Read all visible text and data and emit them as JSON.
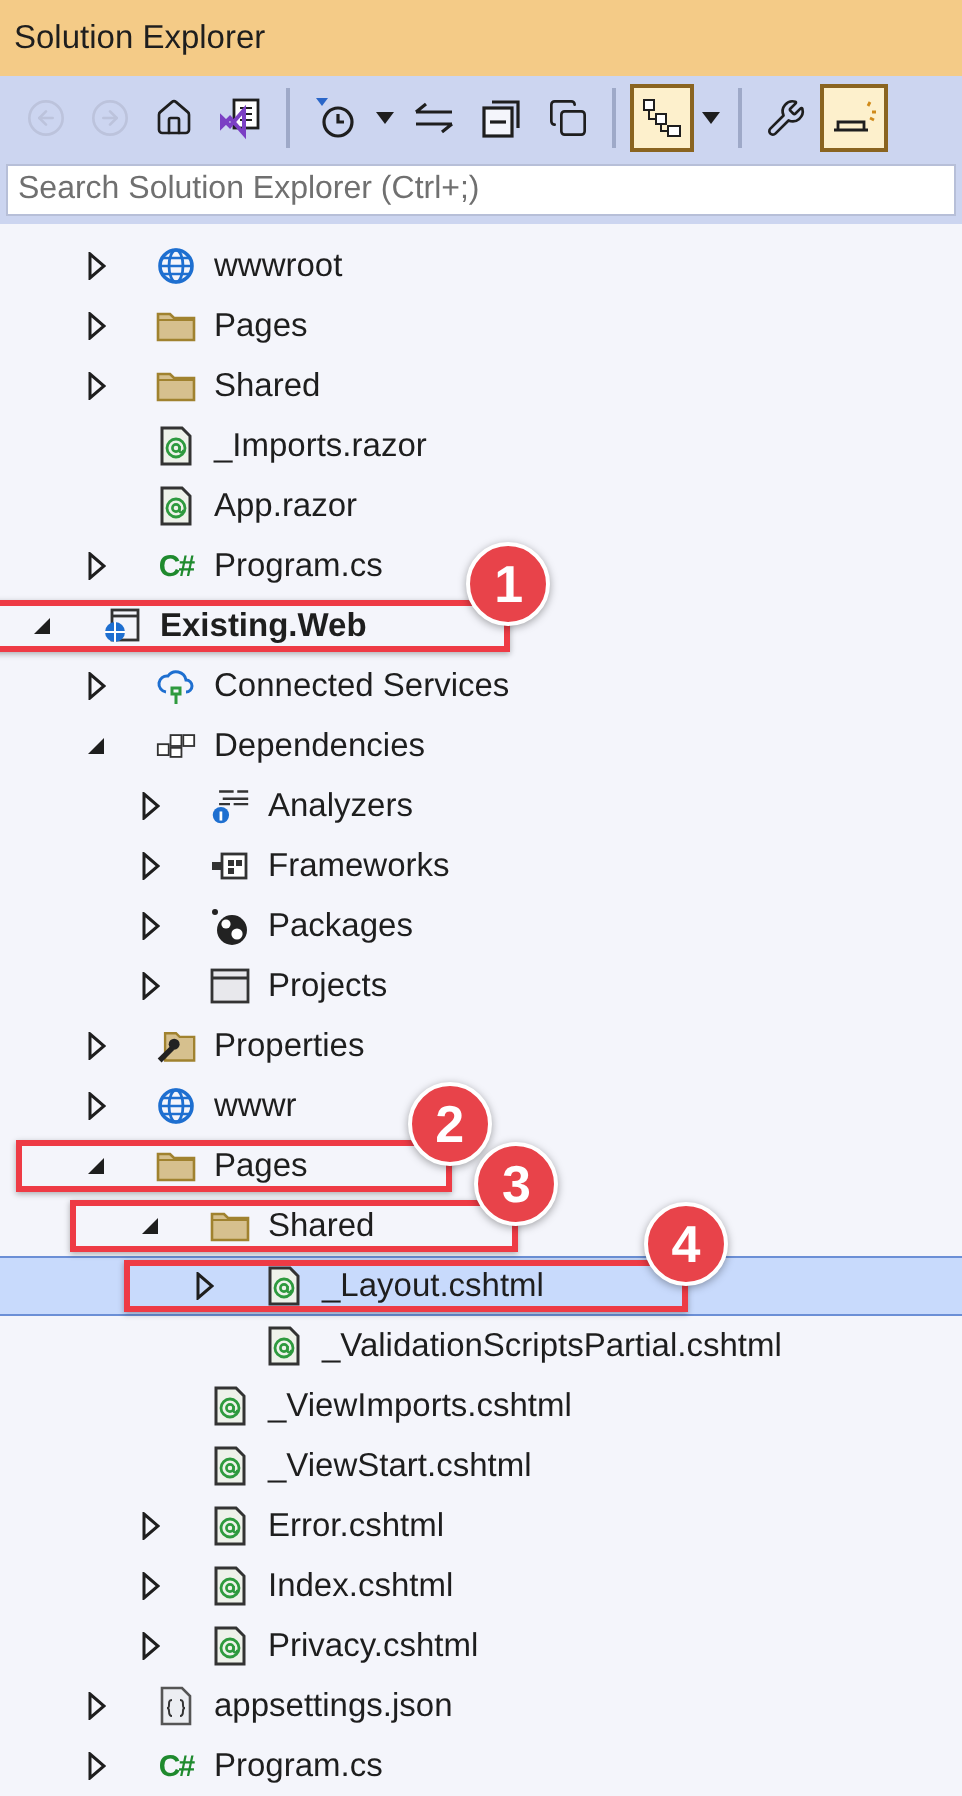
{
  "window": {
    "title": "Solution Explorer"
  },
  "toolbar": [
    {
      "kind": "back",
      "disabled": true
    },
    {
      "kind": "forward",
      "disabled": true
    },
    {
      "kind": "home",
      "disabled": false
    },
    {
      "kind": "solution",
      "disabled": false
    },
    {
      "kind": "separator"
    },
    {
      "kind": "history",
      "disabled": false,
      "dropdown": true
    },
    {
      "kind": "sync",
      "disabled": false
    },
    {
      "kind": "collapse",
      "disabled": false
    },
    {
      "kind": "copies",
      "disabled": false
    },
    {
      "kind": "separator"
    },
    {
      "kind": "tree",
      "disabled": false,
      "toggled": true,
      "dropdown": true
    },
    {
      "kind": "separator"
    },
    {
      "kind": "properties",
      "disabled": false,
      "toggled": false
    },
    {
      "kind": "preview",
      "disabled": false,
      "toggled": true
    }
  ],
  "search": {
    "placeholder": "Search Solution Explorer (Ctrl+;)"
  },
  "tree_continued": [
    {
      "label": "wwwroot",
      "kind": "globe",
      "expanded": false,
      "selected": false
    },
    {
      "label": "Pages",
      "kind": "folder",
      "expanded": false,
      "selected": false
    },
    {
      "label": "Shared",
      "kind": "folder",
      "expanded": false,
      "selected": false
    },
    {
      "label": "_Imports.razor",
      "kind": "razor",
      "selected": false
    },
    {
      "label": "App.razor",
      "kind": "razor",
      "selected": false
    },
    {
      "label": "Program.cs",
      "kind": "csharp",
      "icon_text": "C#",
      "expanded": false,
      "selected": false
    }
  ],
  "tree": [
    {
      "label": "Existing.Web",
      "kind": "project",
      "expanded": true,
      "selected": false,
      "bold": true,
      "callout": "1",
      "children": [
        {
          "label": "Connected Services",
          "kind": "connected",
          "expanded": false,
          "selected": false
        },
        {
          "label": "Dependencies",
          "kind": "dependencies",
          "expanded": true,
          "selected": false,
          "children": [
            {
              "label": "Analyzers",
              "kind": "analyzers",
              "expanded": false,
              "selected": false
            },
            {
              "label": "Frameworks",
              "kind": "frameworks",
              "expanded": false,
              "selected": false
            },
            {
              "label": "Packages",
              "kind": "packages",
              "expanded": false,
              "selected": false
            },
            {
              "label": "Projects",
              "kind": "projects",
              "expanded": false,
              "selected": false
            }
          ]
        },
        {
          "label": "Properties",
          "kind": "properties",
          "expanded": false,
          "selected": false
        },
        {
          "label": "wwwr",
          "kind": "globe",
          "expanded": false,
          "selected": false
        },
        {
          "label": "Pages",
          "kind": "folder",
          "expanded": true,
          "selected": false,
          "callout": "2",
          "children": [
            {
              "label": "Shared",
              "kind": "folder",
              "expanded": true,
              "selected": false,
              "callout": "3",
              "children": [
                {
                  "label": "_Layout.cshtml",
                  "kind": "razor",
                  "expanded": false,
                  "selected": true,
                  "callout": "4"
                },
                {
                  "label": "_ValidationScriptsPartial.cshtml",
                  "kind": "razor",
                  "selected": false
                }
              ]
            },
            {
              "label": "_ViewImports.cshtml",
              "kind": "razor",
              "selected": false
            },
            {
              "label": "_ViewStart.cshtml",
              "kind": "razor",
              "selected": false
            },
            {
              "label": "Error.cshtml",
              "kind": "razor",
              "expanded": false,
              "selected": false
            },
            {
              "label": "Index.cshtml",
              "kind": "razor",
              "expanded": false,
              "selected": false
            },
            {
              "label": "Privacy.cshtml",
              "kind": "razor",
              "expanded": false,
              "selected": false
            }
          ]
        },
        {
          "label": "appsettings.json",
          "kind": "json",
          "expanded": false,
          "selected": false
        },
        {
          "label": "Program.cs",
          "kind": "csharp",
          "icon_text": "C#",
          "expanded": false,
          "selected": false
        }
      ]
    }
  ]
}
